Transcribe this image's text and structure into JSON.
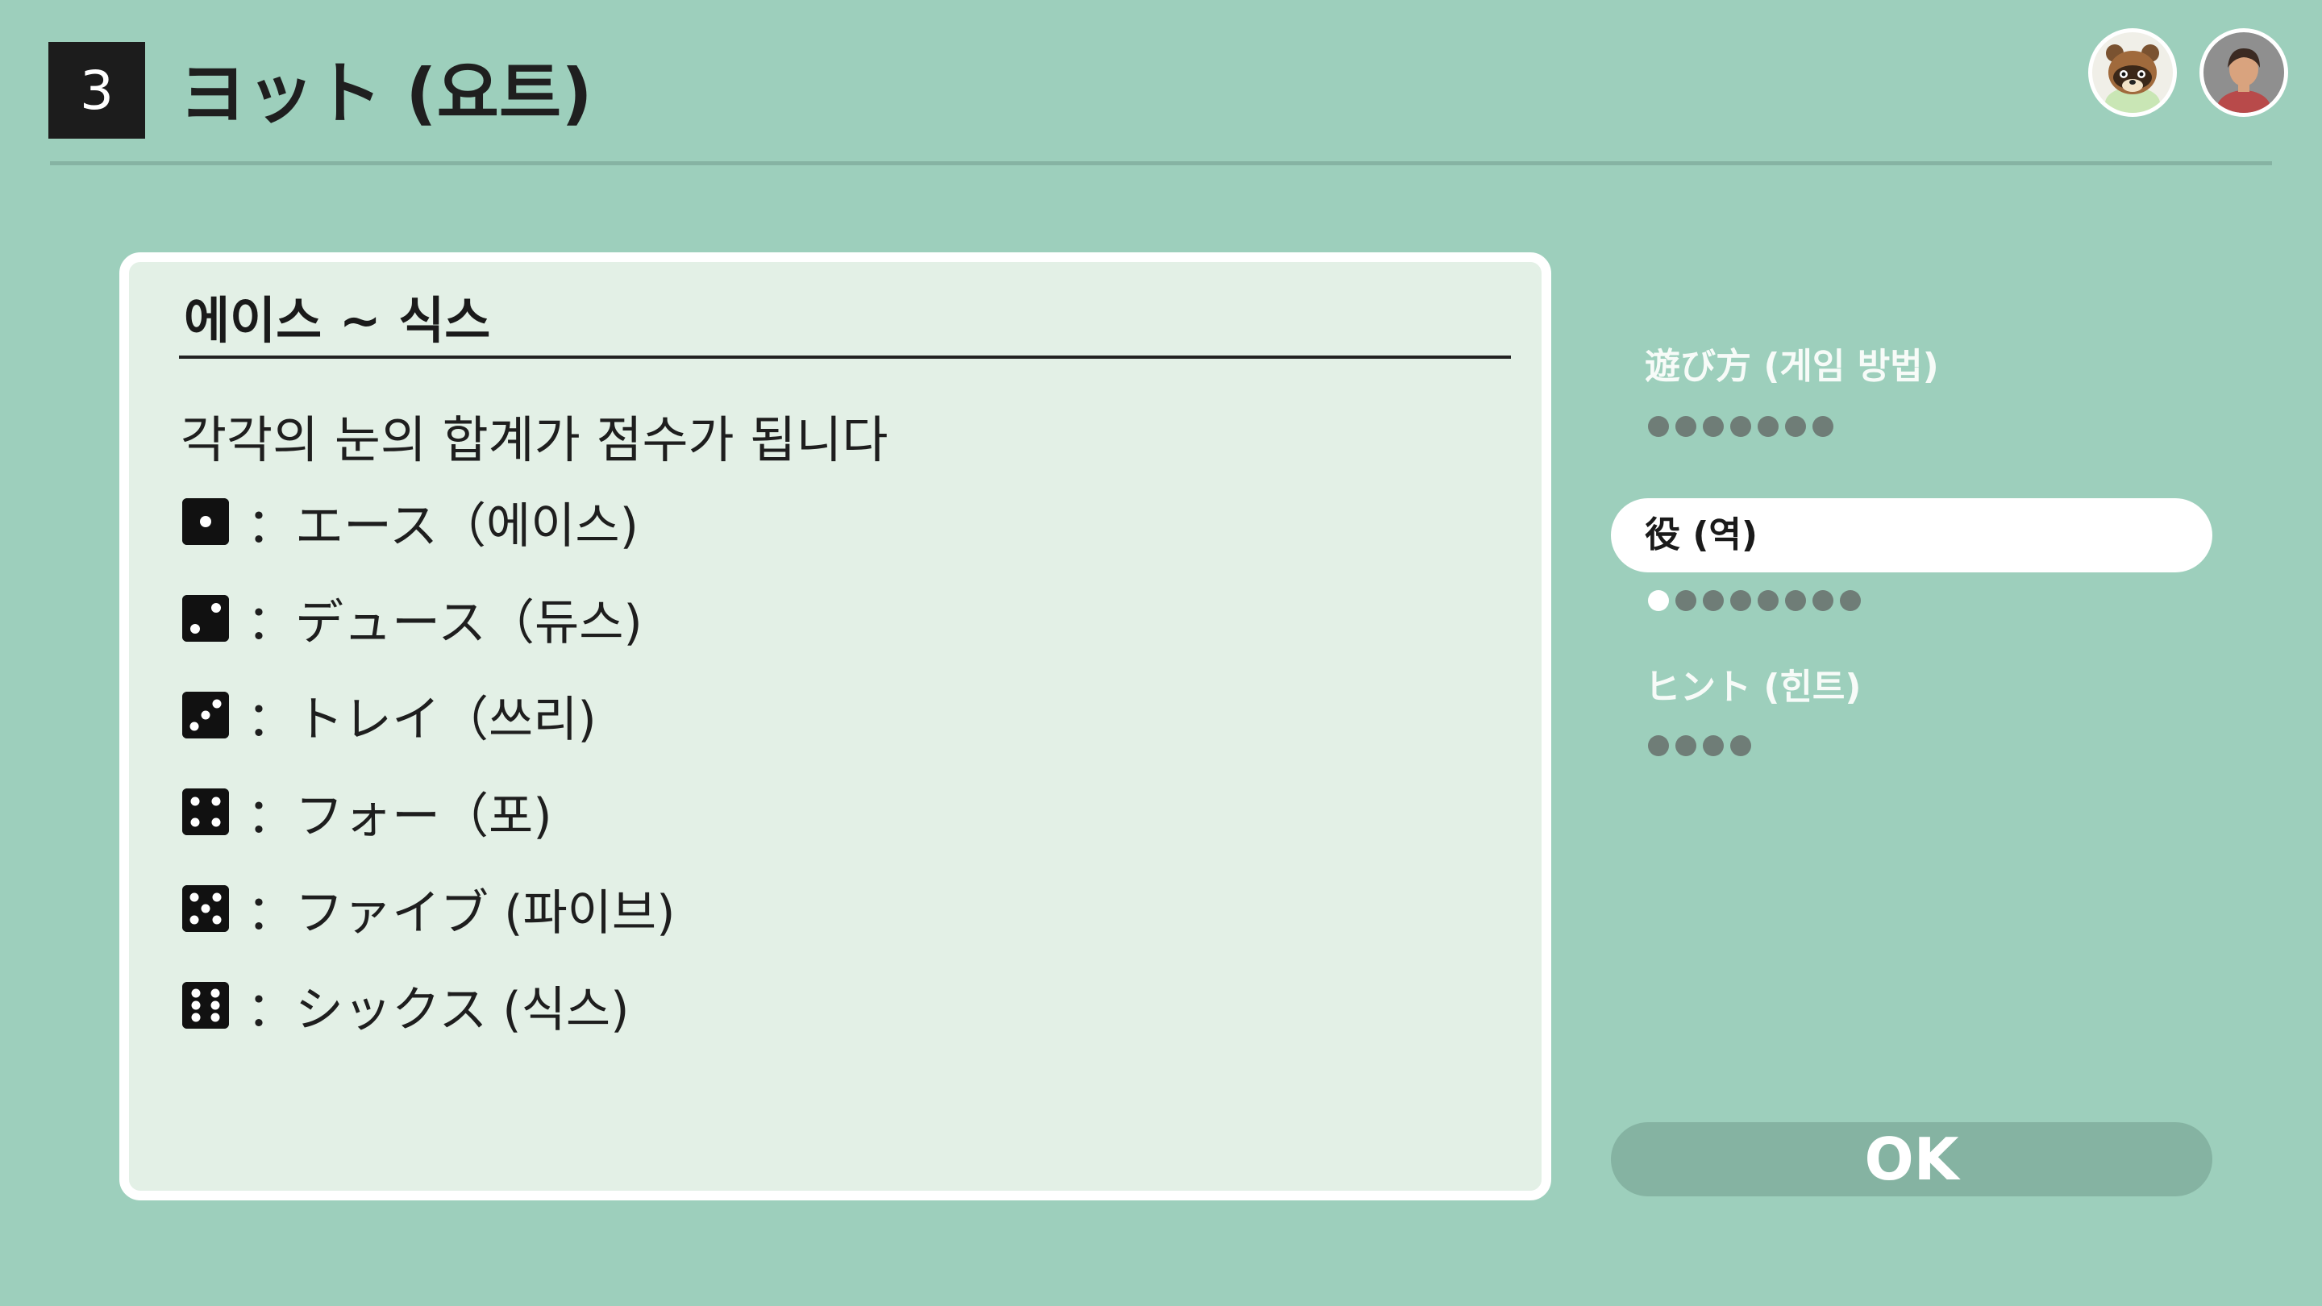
{
  "header": {
    "game_number": "3",
    "title": "ヨット (요트)"
  },
  "users": [
    {
      "name": "tom-nook-avatar"
    },
    {
      "name": "player-avatar"
    }
  ],
  "card": {
    "heading": "에이스 ~ 식스",
    "description": "각각의 눈의 합계가 점수가 됩니다",
    "faces": [
      {
        "pips": 1,
        "label": "：エース（에이스)"
      },
      {
        "pips": 2,
        "label": "：デュース（듀스)"
      },
      {
        "pips": 3,
        "label": "：トレイ（쓰리)"
      },
      {
        "pips": 4,
        "label": "：フォー（포)"
      },
      {
        "pips": 5,
        "label": "：ファイブ (파이브)"
      },
      {
        "pips": 6,
        "label": "：シックス (식스)"
      }
    ]
  },
  "menu": {
    "items": [
      {
        "label": "遊び方 (게임 방법)",
        "pages": 7,
        "current": 0
      },
      {
        "label": "役 (역)",
        "pages": 8,
        "current": 1,
        "active": true
      },
      {
        "label": "ヒント (힌트)",
        "pages": 4,
        "current": 0
      }
    ]
  },
  "ok_label": "OK",
  "colors": {
    "background": "#9dcfbc",
    "card": "#e3f0e6",
    "ok_button": "#85b3a2",
    "dot_inactive": "#6f7d77",
    "dot_active": "#ffffff"
  }
}
